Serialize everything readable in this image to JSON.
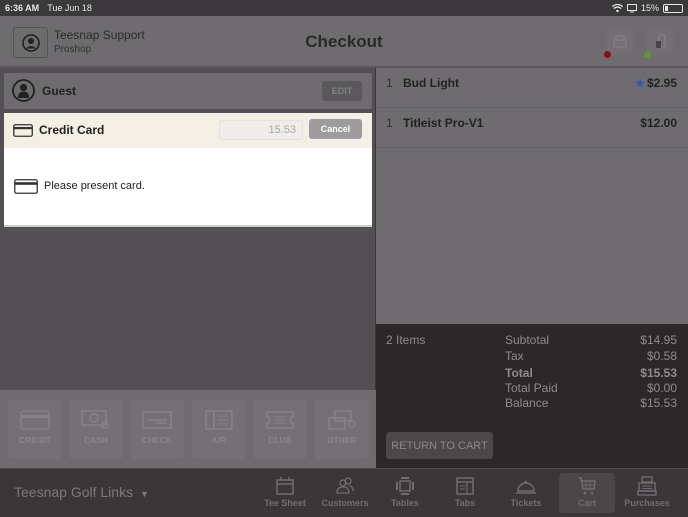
{
  "status_bar": {
    "time": "6:36 AM",
    "date": "Tue Jun 18",
    "battery": "15%",
    "battery_level": 0.15,
    "icons": [
      "wifi-icon",
      "screen-mirror-icon",
      "battery-icon"
    ]
  },
  "header": {
    "user_name": "Teesnap Support",
    "user_role": "Proshop",
    "title": "Checkout",
    "devices": [
      {
        "name": "printer",
        "status_color": "#8b0e17"
      },
      {
        "name": "card-reader",
        "status_color": "#5c9a2c"
      }
    ]
  },
  "customer": {
    "name": "Guest",
    "edit_label": "EDIT"
  },
  "payment": {
    "method": "Credit Card",
    "amount": "15.53",
    "cancel_label": "Cancel",
    "message": "Please present card."
  },
  "payment_methods": [
    {
      "label": "CREDIT",
      "icon": "credit-card-icon"
    },
    {
      "label": "CASH",
      "icon": "cash-icon"
    },
    {
      "label": "CHECK",
      "icon": "check-icon"
    },
    {
      "label": "A/R",
      "icon": "ledger-icon"
    },
    {
      "label": "CLUB",
      "icon": "ticket-icon"
    },
    {
      "label": "OTHER",
      "icon": "other-payment-icon"
    }
  ],
  "cart": {
    "items": [
      {
        "qty": "1",
        "name": "Bud Light",
        "price": "$2.95",
        "starred": true
      },
      {
        "qty": "1",
        "name": "Titleist Pro-V1",
        "price": "$12.00",
        "starred": false
      }
    ],
    "accent_star_color": "#2a5ab8"
  },
  "summary": {
    "items_count": "2 Items",
    "rows": [
      {
        "label": "Subtotal",
        "value": "$14.95",
        "bold": false
      },
      {
        "label": "Tax",
        "value": "$0.58",
        "bold": false
      },
      {
        "label": "Total",
        "value": "$15.53",
        "bold": true
      },
      {
        "label": "Total Paid",
        "value": "$0.00",
        "bold": false
      },
      {
        "label": "Balance",
        "value": "$15.53",
        "bold": false
      }
    ],
    "return_label": "RETURN TO CART"
  },
  "tabbar": {
    "venue": "Teesnap Golf Links",
    "tabs": [
      {
        "label": "Tee Sheet",
        "icon": "calendar-icon",
        "active": false
      },
      {
        "label": "Customers",
        "icon": "customers-icon",
        "active": false
      },
      {
        "label": "Tables",
        "icon": "table-icon",
        "active": false
      },
      {
        "label": "Tabs",
        "icon": "tabs-icon",
        "active": false
      },
      {
        "label": "Tickets",
        "icon": "service-bell-icon",
        "active": false
      },
      {
        "label": "Cart",
        "icon": "cart-icon",
        "active": true
      },
      {
        "label": "Purchases",
        "icon": "cash-register-icon",
        "active": false
      }
    ]
  }
}
